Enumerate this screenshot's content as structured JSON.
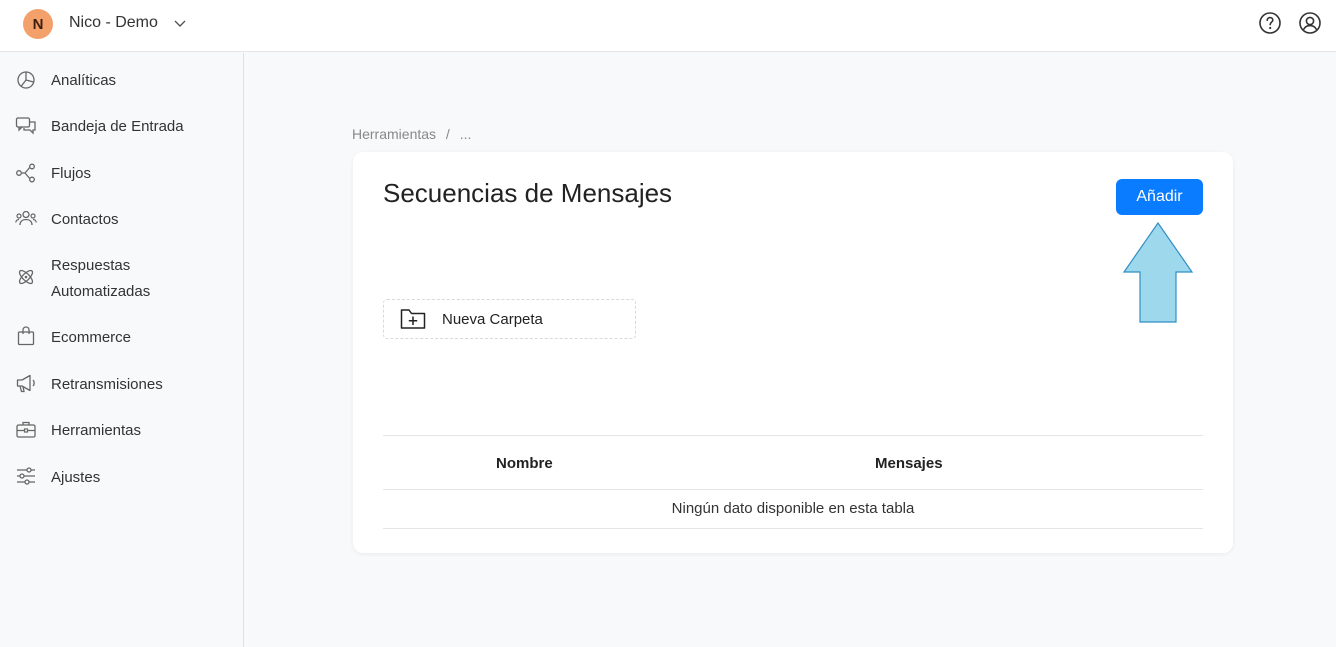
{
  "header": {
    "avatar_letter": "N",
    "workspace_name": "Nico - Demo",
    "avatar_color": "#f4a06a"
  },
  "sidebar": {
    "items": [
      {
        "label": "Analíticas",
        "icon": "pie-chart-icon"
      },
      {
        "label": "Bandeja de Entrada",
        "icon": "chat-bubbles-icon"
      },
      {
        "label": "Flujos",
        "icon": "flow-nodes-icon"
      },
      {
        "label": "Contactos",
        "icon": "contacts-icon"
      },
      {
        "label": "Respuestas",
        "label2": "Automatizadas",
        "icon": "atom-icon"
      },
      {
        "label": "Ecommerce",
        "icon": "shopping-bag-icon"
      },
      {
        "label": "Retransmisiones",
        "icon": "megaphone-icon"
      },
      {
        "label": "Herramientas",
        "icon": "toolbox-icon"
      },
      {
        "label": "Ajustes",
        "icon": "sliders-icon"
      }
    ]
  },
  "breadcrumb": {
    "root": "Herramientas",
    "separator": "/",
    "current": "..."
  },
  "main": {
    "title": "Secuencias de Mensajes",
    "add_label": "Añadir",
    "new_folder_label": "Nueva Carpeta",
    "accent_color": "#0a7cff",
    "arrow_color": "#9dd8ec"
  },
  "table": {
    "columns": [
      "Nombre",
      "Mensajes"
    ],
    "empty_text": "Ningún dato disponible en esta tabla"
  }
}
